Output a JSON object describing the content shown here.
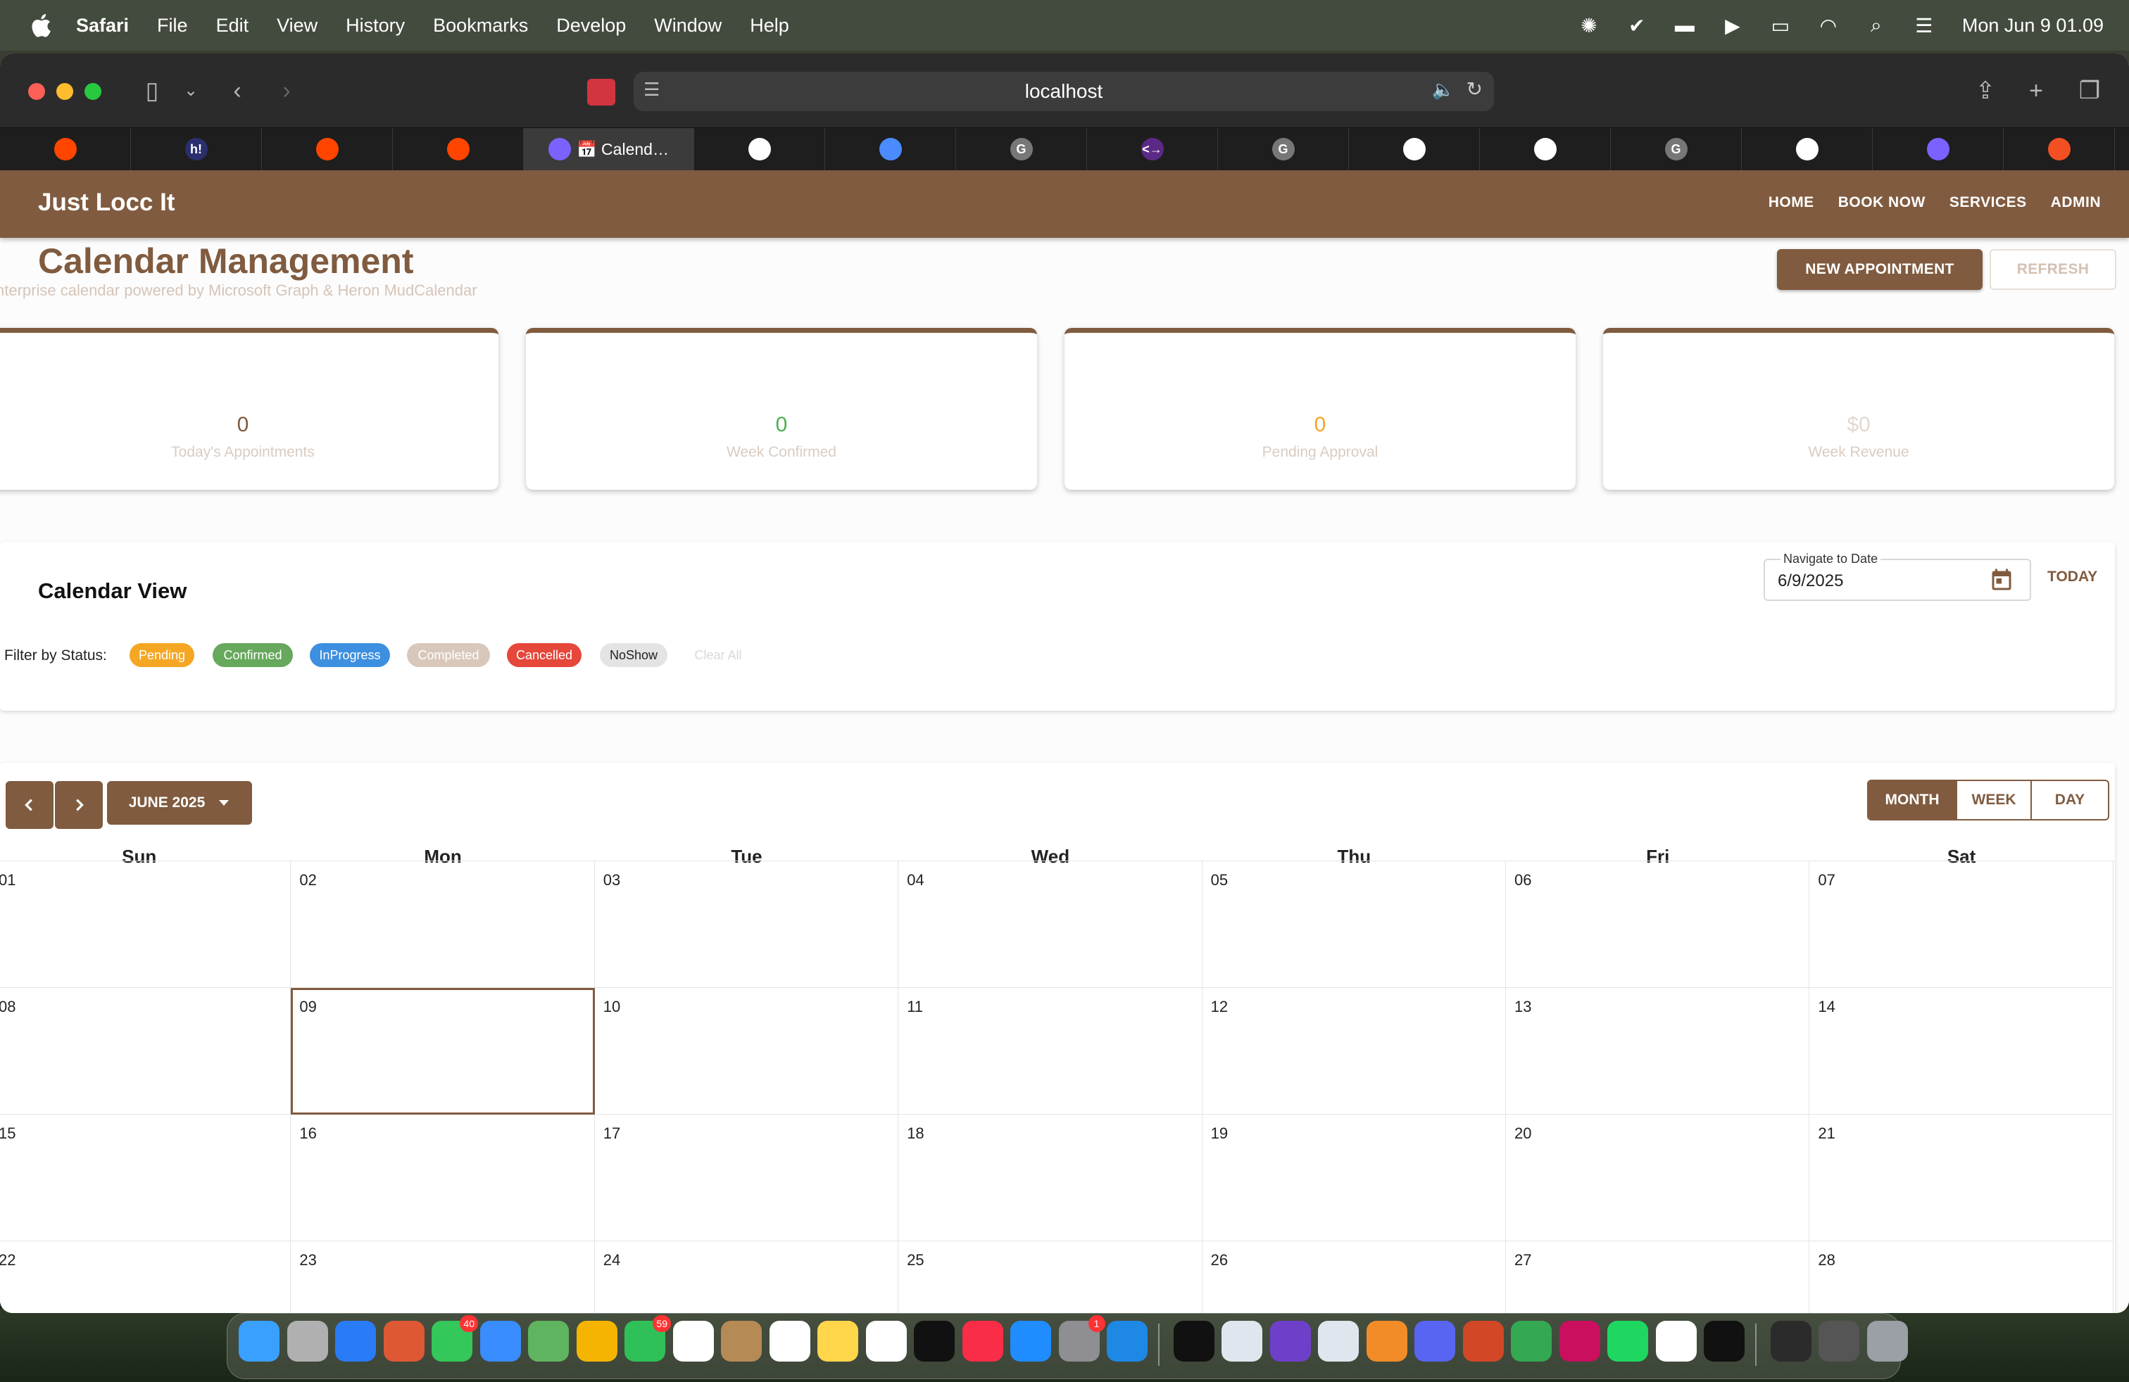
{
  "menubar": {
    "app_name": "Safari",
    "menus": [
      "File",
      "Edit",
      "View",
      "History",
      "Bookmarks",
      "Develop",
      "Window",
      "Help"
    ],
    "clock": "Mon Jun 9  01.09"
  },
  "browser": {
    "url": "localhost",
    "active_tab_title": "📅 Calend…",
    "tabs": [
      {
        "icon": "reddit-icon",
        "color": "#ff4500"
      },
      {
        "icon": "hashnode-icon",
        "color": "#2b2f6e",
        "text": "h!"
      },
      {
        "icon": "reddit-icon",
        "color": "#ff4500"
      },
      {
        "icon": "reddit-icon",
        "color": "#ff4500"
      },
      {
        "icon": "mudblazor-icon",
        "color": "#7b62ff",
        "active": true
      },
      {
        "icon": "github-icon",
        "color": "#ffffff"
      },
      {
        "icon": "app-icon",
        "color": "#4a8cff"
      },
      {
        "icon": "grammarly-g-icon",
        "color": "#777777",
        "text": "G"
      },
      {
        "icon": "terminal-icon",
        "color": "#5b2a86",
        "text": "<→"
      },
      {
        "icon": "grammarly-g-icon",
        "color": "#777777",
        "text": "G"
      },
      {
        "icon": "github-icon",
        "color": "#ffffff"
      },
      {
        "icon": "github-icon",
        "color": "#ffffff"
      },
      {
        "icon": "grammarly-g-icon",
        "color": "#777777",
        "text": "G"
      },
      {
        "icon": "cursor-icon",
        "color": "#ffffff"
      },
      {
        "icon": "mudblazor-icon",
        "color": "#7b62ff"
      },
      {
        "icon": "microsoft-icon",
        "color": "#f25022"
      }
    ]
  },
  "app": {
    "brand": "Just Locc It",
    "nav": [
      "HOME",
      "BOOK NOW",
      "SERVICES",
      "ADMIN"
    ],
    "title": "Calendar Management",
    "subtitle": "nterprise calendar powered by Microsoft Graph & Heron MudCalendar",
    "new_button": "NEW APPOINTMENT",
    "refresh_button": "REFRESH",
    "stats": [
      {
        "value": "0",
        "label": "Today's Appointments",
        "color": "#805b3f"
      },
      {
        "value": "0",
        "label": "Week Confirmed",
        "color": "#4caf50"
      },
      {
        "value": "0",
        "label": "Pending Approval",
        "color": "#f5a623"
      },
      {
        "value": "$0",
        "label": "Week Revenue",
        "color": "#e3d8cf"
      }
    ],
    "calendar_view_title": "Calendar View",
    "navigate_label": "Navigate to Date",
    "navigate_value": "6/9/2025",
    "today_button": "TODAY",
    "filter_label": "Filter by Status:",
    "filters": [
      {
        "label": "Pending",
        "bg": "#f5a623",
        "fg": "#ffffff"
      },
      {
        "label": "Confirmed",
        "bg": "#66a85c",
        "fg": "#ffffff"
      },
      {
        "label": "InProgress",
        "bg": "#3d8fe0",
        "fg": "#ffffff"
      },
      {
        "label": "Completed",
        "bg": "#d8c8bb",
        "fg": "#ffffff"
      },
      {
        "label": "Cancelled",
        "bg": "#e5473a",
        "fg": "#ffffff"
      },
      {
        "label": "NoShow",
        "bg": "#e4e4e4",
        "fg": "#222222"
      },
      {
        "label": "Clear All",
        "bg": "transparent",
        "fg": "#d9d9d9"
      }
    ],
    "month_label": "JUNE 2025",
    "views": [
      "MONTH",
      "WEEK",
      "DAY"
    ],
    "weekdays": [
      "Sun",
      "Mon",
      "Tue",
      "Wed",
      "Thu",
      "Fri",
      "Sat"
    ],
    "weeks": [
      [
        "01",
        "02",
        "03",
        "04",
        "05",
        "06",
        "07"
      ],
      [
        "08",
        "09",
        "10",
        "11",
        "12",
        "13",
        "14"
      ],
      [
        "15",
        "16",
        "17",
        "18",
        "19",
        "20",
        "21"
      ],
      [
        "22",
        "23",
        "24",
        "25",
        "26",
        "27",
        "28"
      ]
    ],
    "today": "09"
  },
  "dock": {
    "apps": [
      {
        "name": "finder-icon",
        "color": "#3aa0ff"
      },
      {
        "name": "launchpad-icon",
        "color": "#b0b0b0"
      },
      {
        "name": "safari-icon",
        "color": "#2a7bf6"
      },
      {
        "name": "duckduckgo-icon",
        "color": "#de5833"
      },
      {
        "name": "messages-icon",
        "color": "#34c759",
        "badge": "40"
      },
      {
        "name": "mail-icon",
        "color": "#3a8dff"
      },
      {
        "name": "maps-icon",
        "color": "#5fb55f"
      },
      {
        "name": "photos-icon",
        "color": "#f4b400"
      },
      {
        "name": "facetime-icon",
        "color": "#2fc158",
        "badge": "59"
      },
      {
        "name": "calendar-icon",
        "color": "#ffffff"
      },
      {
        "name": "contacts-icon",
        "color": "#b68a55"
      },
      {
        "name": "reminders-icon",
        "color": "#ffffff"
      },
      {
        "name": "notes-icon",
        "color": "#ffd54a"
      },
      {
        "name": "freeform-icon",
        "color": "#ffffff"
      },
      {
        "name": "appletv-icon",
        "color": "#111111"
      },
      {
        "name": "music-icon",
        "color": "#fa2d48"
      },
      {
        "name": "appstore-icon",
        "color": "#1f8cff"
      },
      {
        "name": "settings-icon",
        "color": "#8e8e93",
        "badge": "1"
      },
      {
        "name": "vscode-icon",
        "color": "#1e88e5"
      },
      {
        "name": "terminal-icon",
        "color": "#111111"
      },
      {
        "name": "keychain-icon",
        "color": "#dfe6ee"
      },
      {
        "name": "github-desktop-icon",
        "color": "#6e40c9"
      },
      {
        "name": "preview-icon",
        "color": "#dfe6ee"
      },
      {
        "name": "sourcetree-icon",
        "color": "#f28c28"
      },
      {
        "name": "discord-icon",
        "color": "#5865f2"
      },
      {
        "name": "powerpoint-icon",
        "color": "#d24726"
      },
      {
        "name": "chrome-icon",
        "color": "#34a853"
      },
      {
        "name": "rider-icon",
        "color": "#c90f5e"
      },
      {
        "name": "spotify-icon",
        "color": "#1ed760"
      },
      {
        "name": "chatgpt-icon",
        "color": "#ffffff"
      },
      {
        "name": "cursor-icon",
        "color": "#111111"
      },
      {
        "name": "document-icon",
        "color": "#2b2b2b"
      },
      {
        "name": "downloads-icon",
        "color": "#555555"
      },
      {
        "name": "trash-icon",
        "color": "#9aa0a6"
      }
    ]
  }
}
